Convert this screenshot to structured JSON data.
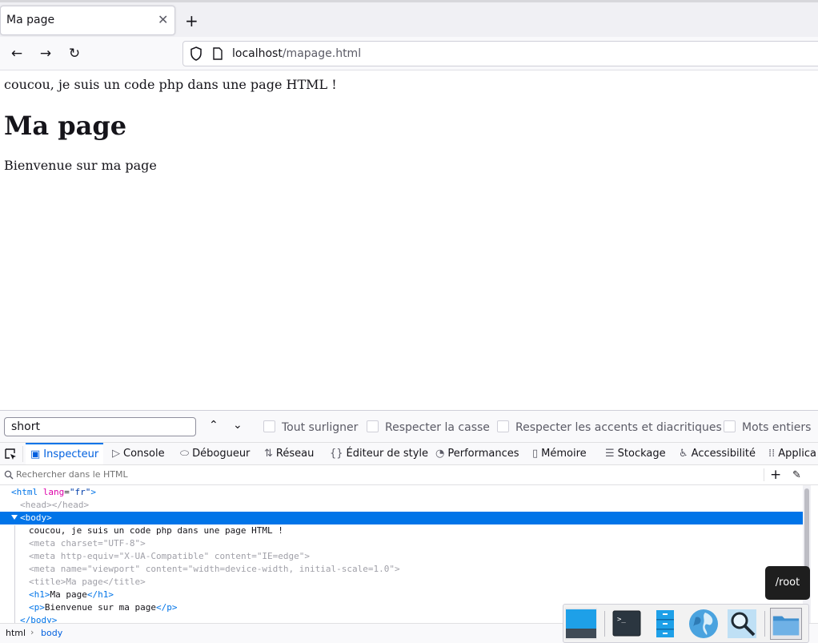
{
  "browser": {
    "tab": {
      "title": "Ma page",
      "close_glyph": "✕"
    },
    "new_tab_glyph": "+",
    "nav": {
      "back_glyph": "←",
      "forward_glyph": "→",
      "reload_glyph": "↻"
    },
    "url": {
      "host": "localhost",
      "path": "/mapage.html"
    }
  },
  "page": {
    "php_line": "coucou, je suis un code php dans une page HTML !",
    "heading": "Ma page",
    "paragraph": "Bienvenue sur ma page"
  },
  "findbar": {
    "query": "short",
    "prev_glyph": "⌃",
    "next_glyph": "⌄",
    "options": [
      "Tout surligner",
      "Respecter la casse",
      "Respecter les accents et diacritiques",
      "Mots entiers"
    ]
  },
  "devtools": {
    "tabs": [
      {
        "label": "Inspecteur",
        "icon": "inspector-icon",
        "glyph": "▣"
      },
      {
        "label": "Console",
        "icon": "console-icon",
        "glyph": "▷"
      },
      {
        "label": "Débogueur",
        "icon": "debugger-icon",
        "glyph": "⬭"
      },
      {
        "label": "Réseau",
        "icon": "network-icon",
        "glyph": "⇅"
      },
      {
        "label": "Éditeur de style",
        "icon": "style-editor-icon",
        "glyph": "{}"
      },
      {
        "label": "Performances",
        "icon": "performance-icon",
        "glyph": "◔"
      },
      {
        "label": "Mémoire",
        "icon": "memory-icon",
        "glyph": "▯"
      },
      {
        "label": "Stockage",
        "icon": "storage-icon",
        "glyph": "☰"
      },
      {
        "label": "Accessibilité",
        "icon": "accessibility-icon",
        "glyph": "♿"
      },
      {
        "label": "Applica",
        "icon": "application-icon",
        "glyph": "⁞⁞"
      }
    ],
    "search_placeholder": "Rechercher dans le HTML",
    "add_glyph": "+",
    "eyedropper_glyph": "✎",
    "tree": {
      "html_open": "<html",
      "html_lang_attr": "lang",
      "html_lang_val": "\"fr\"",
      "html_close_bracket": ">",
      "head": "<head></head>",
      "body_open": "<body>",
      "php_text": "coucou, je suis un code php dans une page HTML !",
      "meta1": {
        "open": "<meta ",
        "attr": "charset",
        "val": "\"UTF-8\"",
        "close": ">"
      },
      "meta2": {
        "open": "<meta ",
        "attr1": "http-equiv",
        "val1": "\"X-UA-Compatible\"",
        "attr2": "content",
        "val2": "\"IE=edge\"",
        "close": ">"
      },
      "meta3": {
        "open": "<meta ",
        "attr1": "name",
        "val1": "\"viewport\"",
        "attr2": "content",
        "val2": "\"width=device-width, initial-scale=1.0\"",
        "close": ">"
      },
      "title": {
        "open": "<title>",
        "text": "Ma page",
        "close": "</title>"
      },
      "h1": {
        "open": "<h1>",
        "text": "Ma page",
        "close": "</h1>"
      },
      "p": {
        "open": "<p>",
        "text": "Bienvenue sur ma page",
        "close": "</p>"
      },
      "body_close": "</body>"
    },
    "breadcrumbs": [
      "html",
      "body"
    ]
  },
  "tooltip": "/root",
  "dock": {
    "items": [
      "desktop-icon",
      "terminal-icon",
      "file-manager-icon",
      "web-browser-icon",
      "search-icon",
      "folder-icon"
    ]
  },
  "colors": {
    "accent": "#0074e8",
    "selection": "#0074e8"
  }
}
